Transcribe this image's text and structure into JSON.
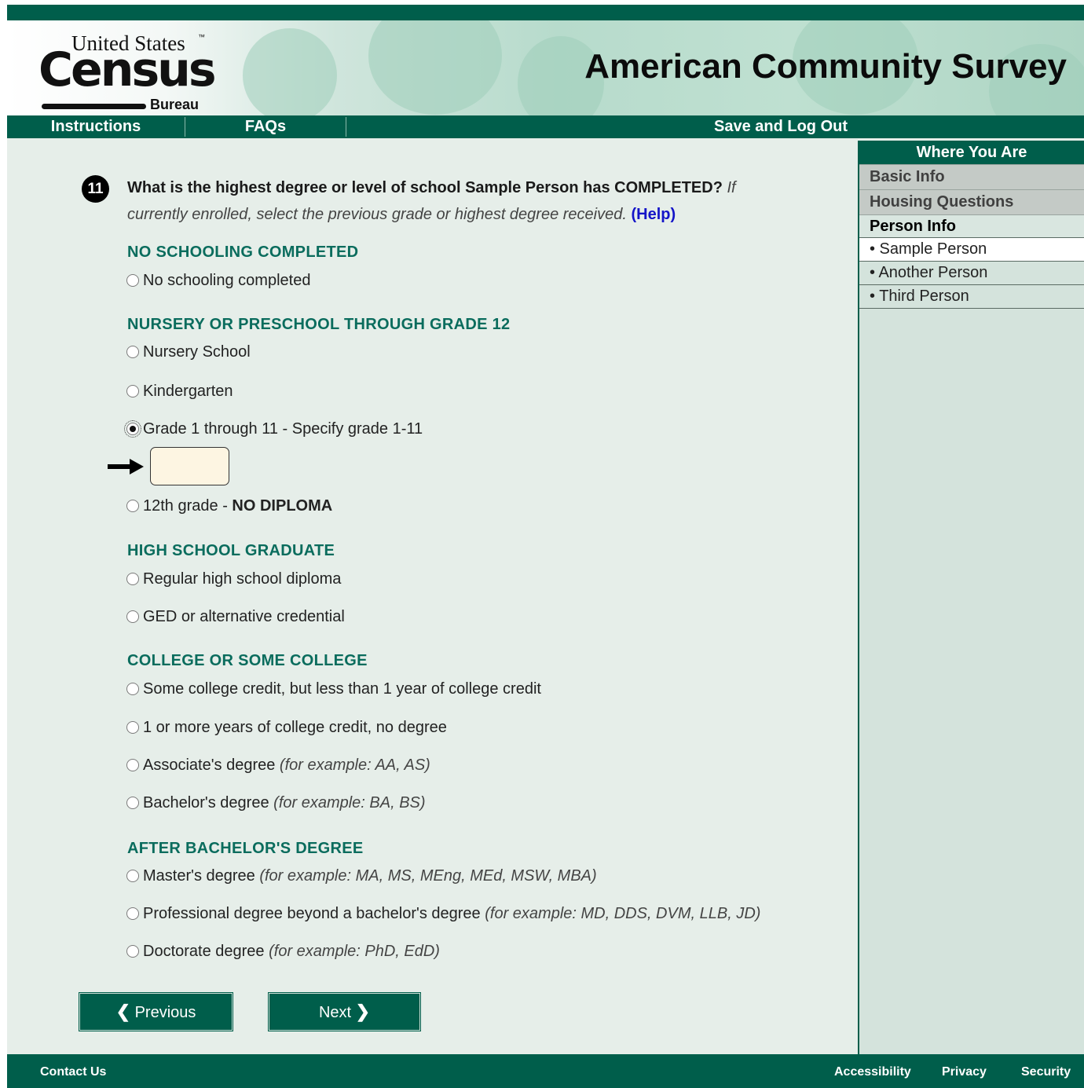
{
  "header": {
    "logo": {
      "united_states": "United States",
      "tm": "™",
      "census": "Census",
      "bureau": "Bureau"
    },
    "title": "American Community Survey"
  },
  "nav": {
    "instructions": "Instructions",
    "faqs": "FAQs",
    "save_logout": "Save and Log Out"
  },
  "sidebar": {
    "heading": "Where You Are",
    "sections": {
      "basic": "Basic Info",
      "housing": "Housing Questions",
      "person": "Person Info"
    },
    "persons": [
      "• Sample Person",
      "• Another Person",
      "• Third Person"
    ],
    "current_person_index": 0
  },
  "question": {
    "number": "11",
    "text": "What is the highest degree or level of school Sample Person has COMPLETED?",
    "note": "If currently enrolled, select the previous grade or highest degree received.",
    "help": "(Help)"
  },
  "categories": {
    "none": "NO SCHOOLING COMPLETED",
    "k12": "NURSERY OR PRESCHOOL THROUGH GRADE 12",
    "hs": "HIGH SCHOOL GRADUATE",
    "college": "COLLEGE OR SOME COLLEGE",
    "after": "AFTER BACHELOR'S DEGREE"
  },
  "options": {
    "no_schooling": "No schooling completed",
    "nursery": "Nursery School",
    "kindergarten": "Kindergarten",
    "grade_1_11": "Grade 1 through 11 - Specify grade 1-11",
    "grade_12_prefix": "12th grade - ",
    "grade_12_bold": "NO DIPLOMA",
    "regular_diploma": "Regular high school diploma",
    "ged": "GED or alternative credential",
    "some_college": "Some college credit, but less than 1 year of college credit",
    "one_plus_years": "1 or more years of college credit, no degree",
    "associate": "Associate's degree",
    "associate_ex": "(for example: AA, AS)",
    "bachelor": "Bachelor's degree",
    "bachelor_ex": "(for example: BA, BS)",
    "master": "Master's degree",
    "master_ex": "(for example: MA, MS, MEng, MEd, MSW, MBA)",
    "professional": "Professional degree beyond a bachelor's degree",
    "professional_ex": "(for example: MD, DDS, DVM, LLB, JD)",
    "doctorate": "Doctorate degree",
    "doctorate_ex": "(for example: PhD, EdD)"
  },
  "selected_option": "grade_1_11",
  "grade_input": {
    "value": ""
  },
  "buttons": {
    "previous": "Previous",
    "next": "Next",
    "prev_icon": "❮",
    "next_icon": "❯"
  },
  "footer": {
    "contact": "Contact Us",
    "accessibility": "Accessibility",
    "privacy": "Privacy",
    "security": "Security"
  },
  "colors": {
    "brand_green": "#005e4b",
    "category_green": "#0a6c5d",
    "help_blue": "#1414c8",
    "input_bg": "#fdf5e2"
  }
}
